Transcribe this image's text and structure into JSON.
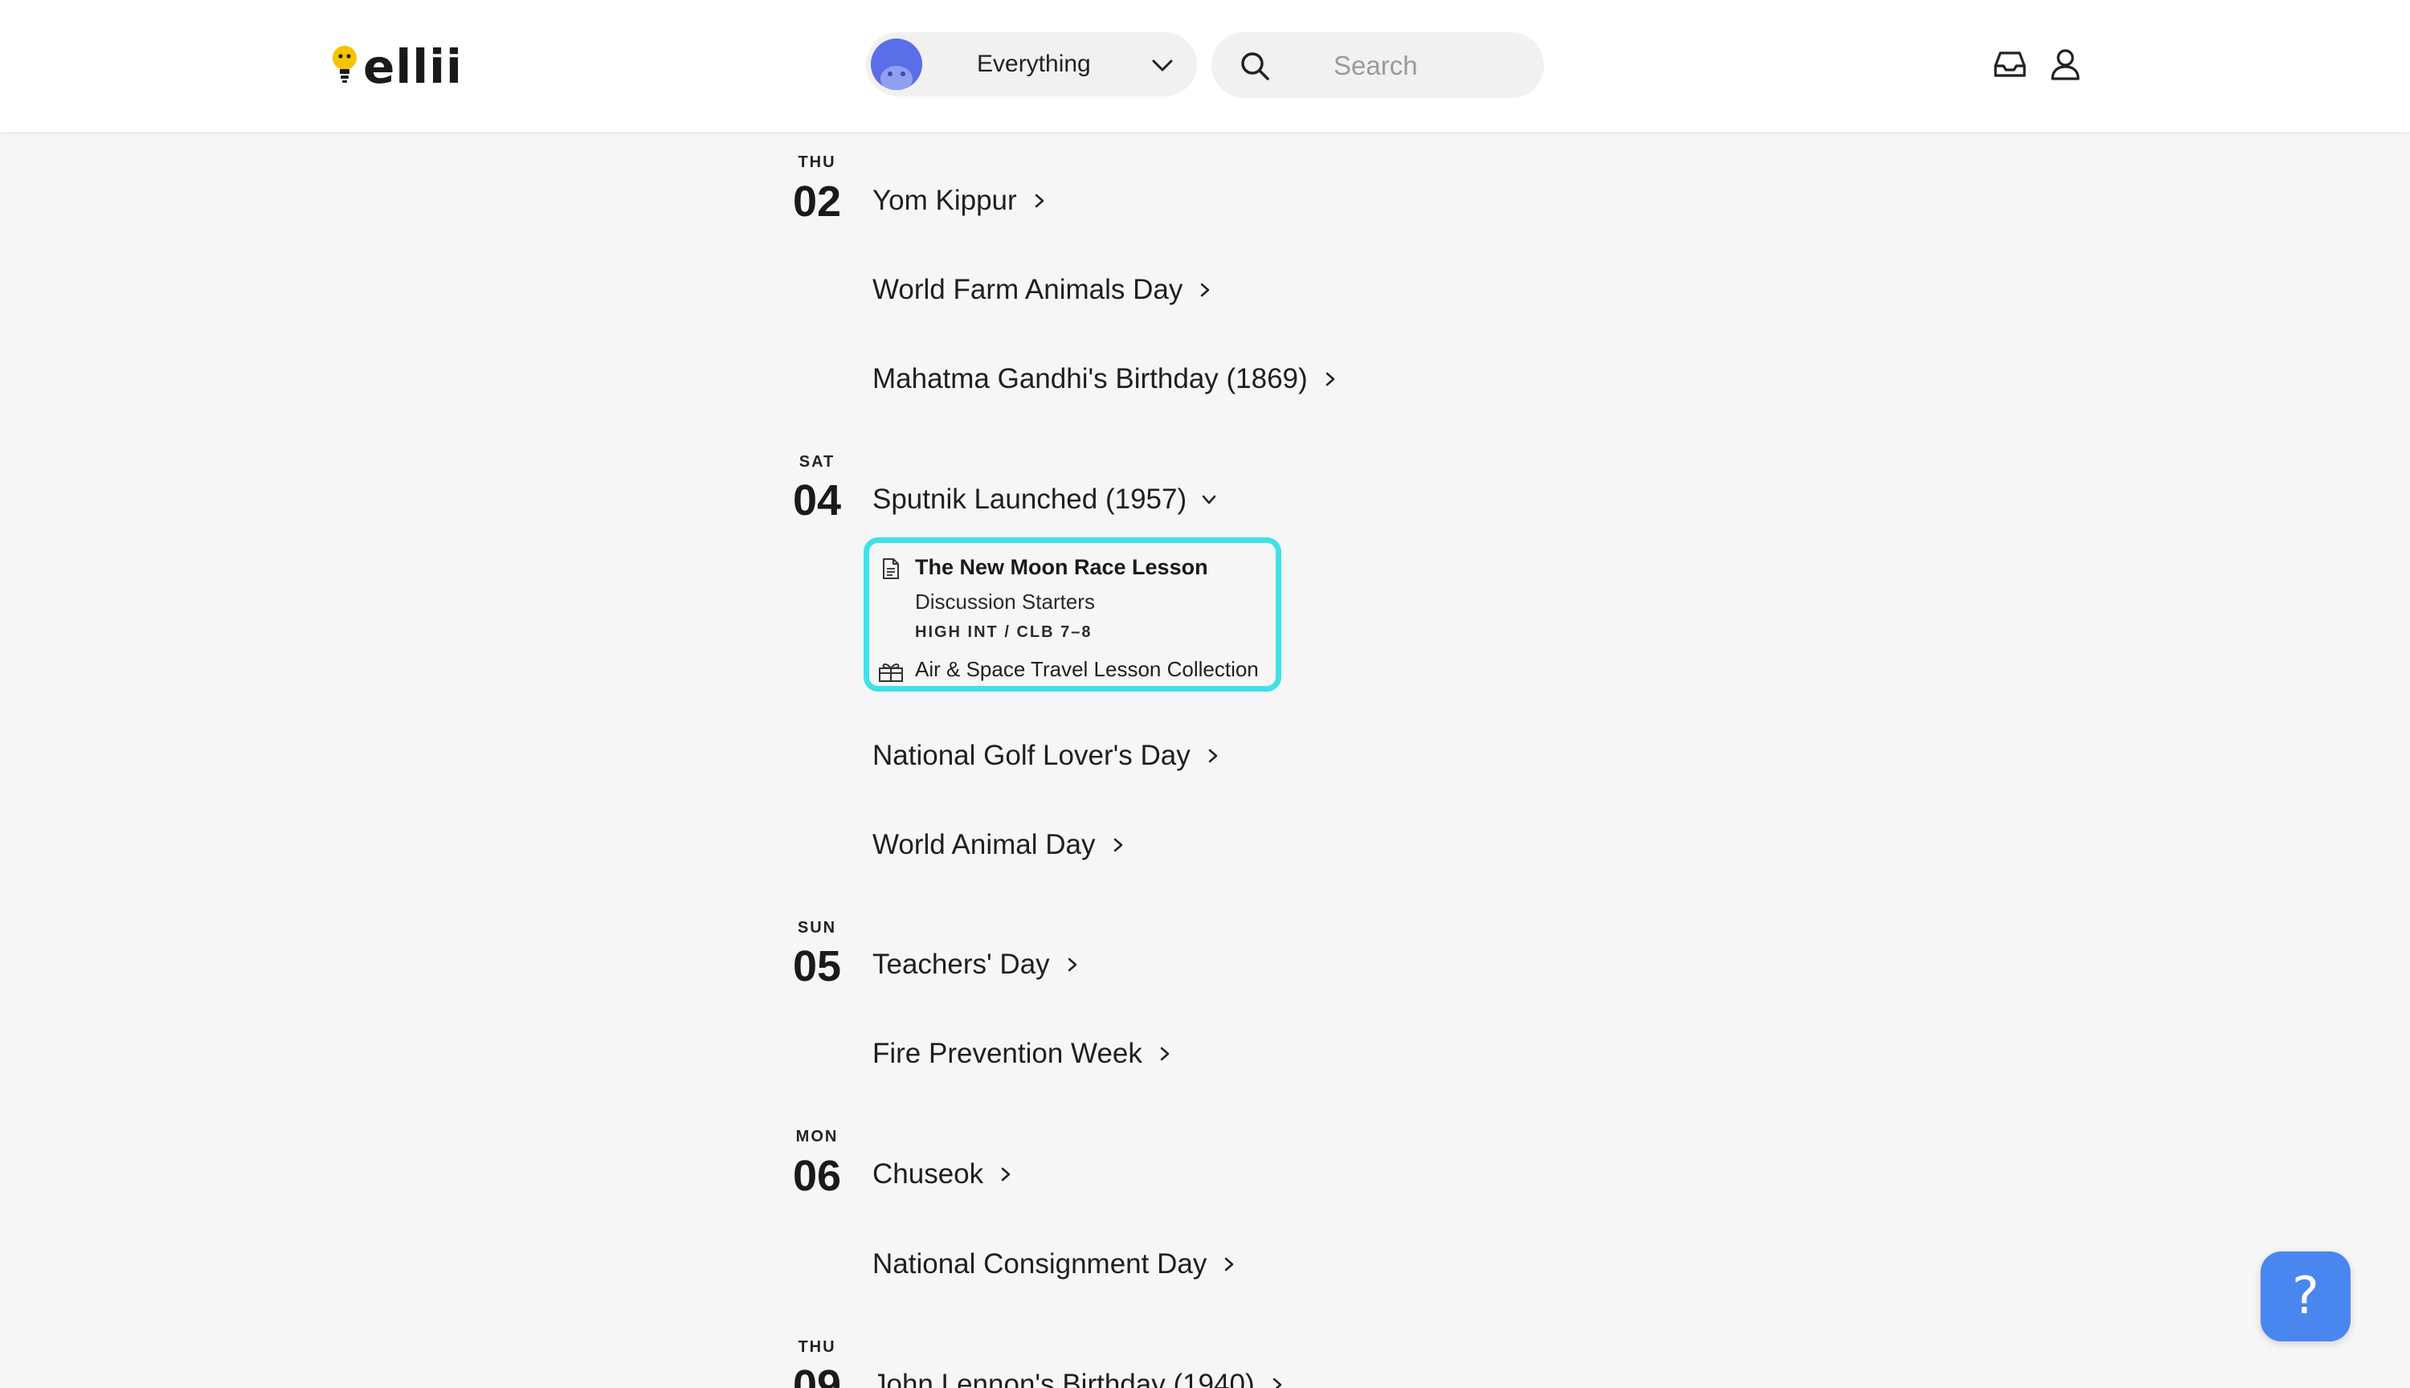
{
  "header": {
    "logo_text": "ellii",
    "filter": {
      "selected": "Everything"
    },
    "search": {
      "placeholder": "Search"
    },
    "icons": [
      "inbox-icon",
      "user-icon"
    ]
  },
  "calendar": {
    "days": [
      {
        "dow": "THU",
        "date": "02",
        "events": [
          "Yom Kippur",
          "World Farm Animals Day",
          "Mahatma Gandhi's Birthday (1869)"
        ]
      },
      {
        "dow": "SAT",
        "date": "04",
        "events": [
          "Sputnik Launched (1957)",
          "National Golf Lover's Day",
          "World Animal Day"
        ],
        "expanded_event": {
          "title": "The New Moon Race Lesson",
          "type": "Discussion Starters",
          "level": "HIGH INT / CLB 7–8",
          "collection": "Air & Space Travel Lesson Collection"
        }
      },
      {
        "dow": "SUN",
        "date": "05",
        "events": [
          "Teachers' Day",
          "Fire Prevention Week"
        ]
      },
      {
        "dow": "MON",
        "date": "06",
        "events": [
          "Chuseok",
          "National Consignment Day"
        ]
      },
      {
        "dow": "THU",
        "date": "09",
        "events": [
          "John Lennon's Birthday (1940)"
        ]
      }
    ]
  },
  "help_button": {
    "label": "?"
  },
  "colors": {
    "highlight_border": "#3ee1ea",
    "help_button": "#4a86f0",
    "avatar": "#5b6ee8",
    "logo_bulb": "#f5c400"
  }
}
